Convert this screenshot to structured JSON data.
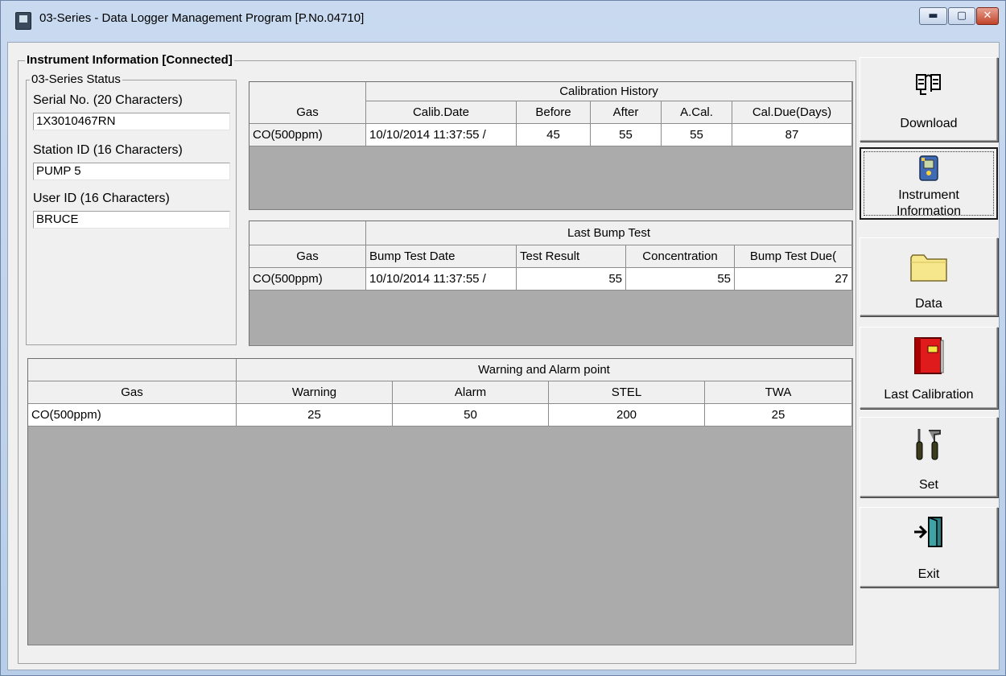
{
  "window": {
    "title": "03-Series  - Data Logger Management Program [P.No.04710]",
    "controls": {
      "minimize": "▬",
      "maximize": "▢",
      "close": "✕"
    }
  },
  "instrument_info": {
    "group_title": "Instrument Information [Connected]",
    "status": {
      "group_title": "03-Series Status",
      "serial_label": "Serial No. (20 Characters)",
      "serial_value": "1X3010467RN",
      "station_label": "Station ID (16 Characters)",
      "station_value": "PUMP 5",
      "user_label": "User ID (16 Characters)",
      "user_value": "BRUCE"
    },
    "calibration_history": {
      "title": "Calibration History",
      "columns": [
        "Gas",
        "Calib.Date",
        "Before",
        "After",
        "A.Cal.",
        "Cal.Due(Days)"
      ],
      "rows": [
        [
          "CO(500ppm)",
          "10/10/2014 11:37:55 /",
          "45",
          "55",
          "55",
          "87"
        ]
      ]
    },
    "bump_test": {
      "title": "Last Bump Test",
      "columns": [
        "Gas",
        "Bump Test Date",
        "Test Result",
        "Concentration",
        "Bump Test Due("
      ],
      "rows": [
        [
          "CO(500ppm)",
          "10/10/2014 11:37:55 /",
          "55",
          "55",
          "27"
        ]
      ]
    },
    "alarm_points": {
      "title": "Warning and Alarm point",
      "columns": [
        "Gas",
        "Warning",
        "Alarm",
        "STEL",
        "TWA"
      ],
      "rows": [
        [
          "CO(500ppm)",
          "25",
          "50",
          "200",
          "25"
        ]
      ]
    }
  },
  "sidebar": {
    "download": "Download",
    "instrument_information_line1": "Instrument",
    "instrument_information_line2": "Information",
    "data": "Data",
    "last_calibration": "Last Calibration",
    "set": "Set",
    "exit": "Exit"
  }
}
